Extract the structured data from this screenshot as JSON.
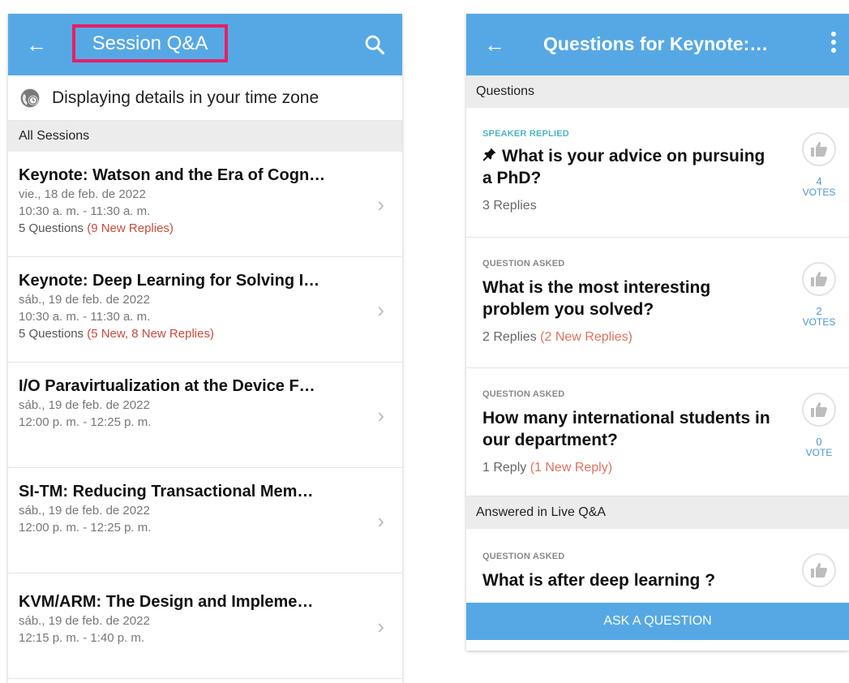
{
  "left_screen": {
    "title": "Session Q&A",
    "back_icon": "←",
    "timezone_text": "Displaying details in your time zone",
    "section_header": "All Sessions",
    "sessions": [
      {
        "title": "Keynote: Watson and the Era of Cogn…",
        "date": "vie., 18 de feb. de 2022",
        "time": "10:30 a. m. - 11:30 a. m.",
        "questions": "5 Questions",
        "new": "(9 New Replies)"
      },
      {
        "title": "Keynote: Deep Learning for Solving I…",
        "date": "sáb., 19 de feb. de 2022",
        "time": "10:30 a. m. - 11:30 a. m.",
        "questions": "5 Questions",
        "new": "(5 New, 8 New Replies)"
      },
      {
        "title": "I/O Paravirtualization at the Device F…",
        "date": "sáb., 19 de feb. de 2022",
        "time": "12:00 p. m. - 12:25 p. m.",
        "questions": "",
        "new": ""
      },
      {
        "title": "SI-TM: Reducing Transactional Mem…",
        "date": "sáb., 19 de feb. de 2022",
        "time": "12:00 p. m. - 12:25 p. m.",
        "questions": "",
        "new": ""
      },
      {
        "title": "KVM/ARM: The Design and Impleme…",
        "date": "sáb., 19 de feb. de 2022",
        "time": "12:15 p. m. - 1:40 p. m.",
        "questions": "",
        "new": ""
      }
    ]
  },
  "right_screen": {
    "title": "Questions for Keynote:…",
    "back_icon": "←",
    "section_questions": "Questions",
    "section_answered": "Answered in Live Q&A",
    "questions": [
      {
        "status": "SPEAKER REPLIED",
        "title": "What is your advice on pursuing a PhD?",
        "replies": "3 Replies",
        "new": "",
        "votes": "4",
        "vote_label": "VOTES"
      },
      {
        "status": "QUESTION ASKED",
        "title": "What is the most interesting problem you solved?",
        "replies": "2 Replies",
        "new": "(2 New Replies)",
        "votes": "2",
        "vote_label": "VOTES"
      },
      {
        "status": "QUESTION ASKED",
        "title": "How many international students in our department?",
        "replies": "1 Reply",
        "new": "(1 New Reply)",
        "votes": "0",
        "vote_label": "VOTE"
      }
    ],
    "answered": [
      {
        "status": "QUESTION ASKED",
        "title": "What is after deep learning ?"
      }
    ],
    "ask_button": "ASK A QUESTION"
  },
  "colors": {
    "app_bar": "#56a8e5",
    "highlight_box": "#e91e63",
    "new_replies_left": "#c94a3c",
    "new_replies_right": "#e0725c",
    "speaker_replied": "#4db5c4",
    "vote_text": "#4b96d6"
  },
  "icons": [
    "back-arrow-icon",
    "search-icon",
    "timezone-globe-icon",
    "chevron-right-icon",
    "more-vert-icon",
    "pin-icon",
    "thumbs-up-icon"
  ]
}
